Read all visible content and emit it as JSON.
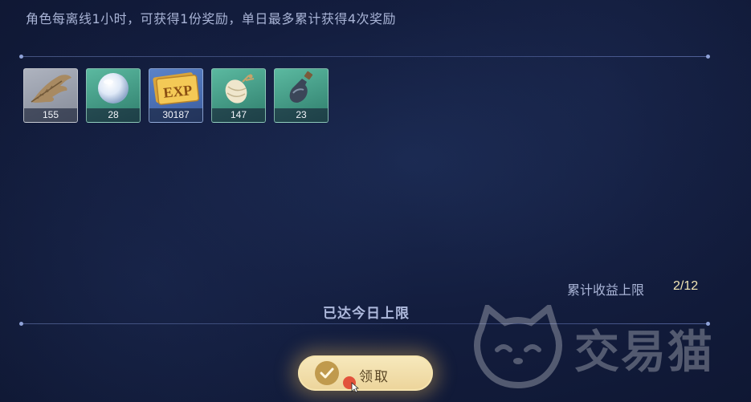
{
  "description": "角色每离线1小时，可获得1份奖励，单日最多累计获得4次奖励",
  "rewards": [
    {
      "name": "feather",
      "count": "155",
      "rarity_color": "#9aa0ad"
    },
    {
      "name": "pearl",
      "count": "28",
      "rarity_color": "#4aa891"
    },
    {
      "name": "exp-ticket",
      "count": "30187",
      "rarity_color": "#4d72b8"
    },
    {
      "name": "wrapped-sack",
      "count": "147",
      "rarity_color": "#4aa891"
    },
    {
      "name": "potion-bottle",
      "count": "23",
      "rarity_color": "#4aa891"
    }
  ],
  "cumulative": {
    "label": "累计收益上限",
    "value": "2/12"
  },
  "limit_status": "已达今日上限",
  "claim_button": {
    "label": "领取"
  },
  "exp_label": "EXP",
  "watermark": {
    "text": "交易猫"
  },
  "colors": {
    "background": "#131d3e",
    "button_gold": "#ecd49a",
    "accent_value": "#f2e6b5"
  }
}
